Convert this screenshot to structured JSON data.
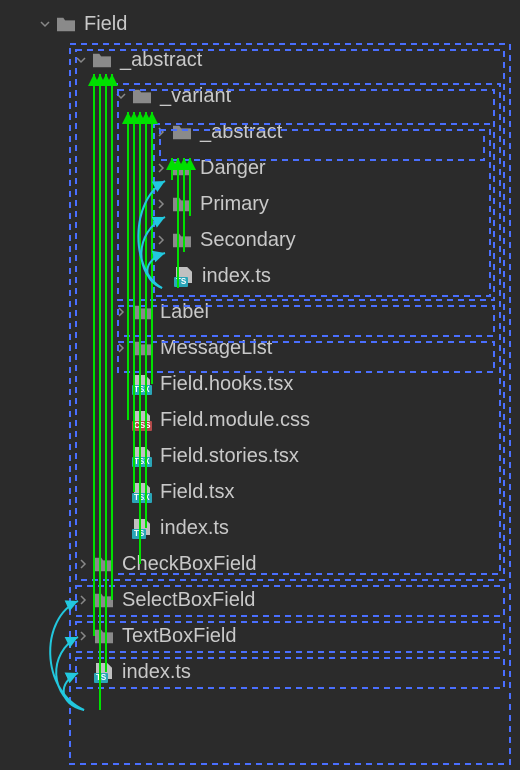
{
  "tree": {
    "root": "Field",
    "abstract": "_abstract",
    "variant": "_variant",
    "variant_abstract": "_abstract",
    "danger": "Danger",
    "primary": "Primary",
    "secondary": "Secondary",
    "variant_index": "index.ts",
    "label_dir": "Label",
    "messagelist": "MessageList",
    "hooks": "Field.hooks.tsx",
    "module_css": "Field.module.css",
    "stories": "Field.stories.tsx",
    "field_tsx": "Field.tsx",
    "abstract_index": "index.ts",
    "checkbox": "CheckBoxField",
    "selectbox": "SelectBoxField",
    "textbox": "TextBoxField",
    "root_index": "index.ts"
  },
  "badges": {
    "ts": "TS",
    "tsx": "TSX",
    "css": "CSS"
  }
}
